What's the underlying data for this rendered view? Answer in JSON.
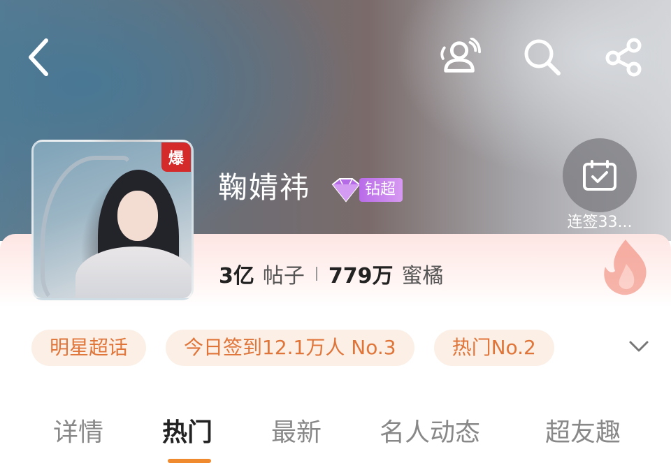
{
  "header": {
    "icons": [
      "back-icon",
      "members-icon",
      "search-icon",
      "share-icon"
    ]
  },
  "profile": {
    "badge": "爆",
    "name": "鞠婧祎",
    "tier_label": "钻超",
    "checkin_label": "连签33...",
    "stats": {
      "posts_value": "3亿",
      "posts_unit": "帖子",
      "fans_value": "779万",
      "fans_unit": "蜜橘"
    }
  },
  "chips": [
    {
      "label": "明星超话"
    },
    {
      "label": "今日签到12.1万人 No.3"
    },
    {
      "label": "热门No.2"
    }
  ],
  "tabs": [
    {
      "label": "详情"
    },
    {
      "label": "热门"
    },
    {
      "label": "最新"
    },
    {
      "label": "名人动态"
    },
    {
      "label": "超友趣"
    }
  ],
  "colors": {
    "accent": "#f08a2e",
    "chip_text": "#e0753a",
    "chip_bg": "#fbefe6",
    "tier": "#c27fee",
    "badge": "#d42a2a"
  }
}
